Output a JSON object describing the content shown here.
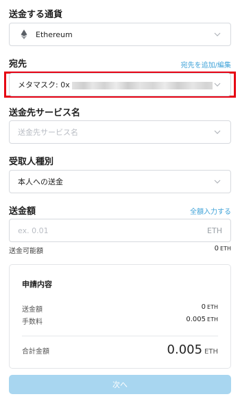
{
  "currency": {
    "label": "送金する通貨",
    "selected": "Ethereum",
    "icon": "ethereum-icon"
  },
  "destination": {
    "label": "宛先",
    "link": "宛先を追加/編集",
    "selected_prefix": "メタマスク: 0x",
    "highlight_color": "#e60012"
  },
  "service": {
    "label": "送金先サービス名",
    "placeholder": "送金先サービス名"
  },
  "recipient_type": {
    "label": "受取人種別",
    "selected": "本人への送金"
  },
  "amount": {
    "label": "送金額",
    "link": "全額入力する",
    "placeholder": "ex. 0.01",
    "unit": "ETH"
  },
  "available": {
    "label": "送金可能額",
    "value": "0",
    "unit": "ETH"
  },
  "summary": {
    "title": "申請内容",
    "rows": [
      {
        "label": "送金額",
        "value": "0",
        "unit": "ETH"
      },
      {
        "label": "手数料",
        "value": "0.005",
        "unit": "ETH"
      }
    ],
    "total_label": "合計金額",
    "total_value": "0.005",
    "total_unit": "ETH"
  },
  "next_button": "次へ",
  "colors": {
    "accent_link": "#3ea2d8",
    "button_disabled": "#a8d6f0"
  }
}
